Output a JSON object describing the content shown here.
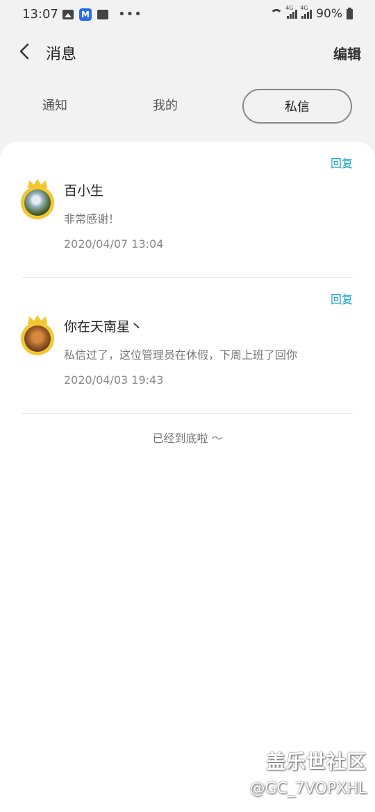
{
  "status_bar": {
    "time": "13:07",
    "network_label_1": "4G",
    "network_label_2": "4G",
    "battery": "90%"
  },
  "header": {
    "title": "消息",
    "edit_label": "编辑"
  },
  "tabs": [
    {
      "label": "通知"
    },
    {
      "label": "我的"
    },
    {
      "label": "私信",
      "active": true
    }
  ],
  "messages": [
    {
      "name": "百小生",
      "text": "非常感谢！",
      "time": "2020/04/07 13:04",
      "reply_label": "回复"
    },
    {
      "name": "你在天南星丶",
      "text": "私信过了，这位管理员在休假，下周上班了回你",
      "time": "2020/04/03 19:43",
      "reply_label": "回复"
    }
  ],
  "end_note": "已经到底啦 ～",
  "watermark": {
    "line1": "盖乐世社区",
    "line2": "@GC_7VOPXHL"
  },
  "colors": {
    "accent": "#1aa3c8",
    "background": "#f2f2f2",
    "card": "#ffffff",
    "avatar_ring": "#f4c631"
  }
}
